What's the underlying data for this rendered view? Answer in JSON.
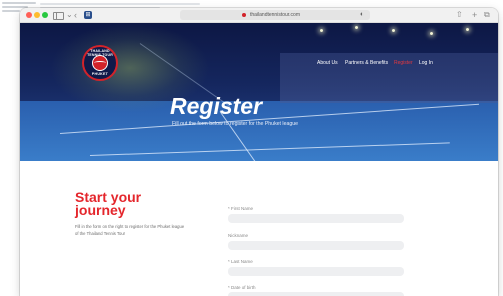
{
  "browser": {
    "url": "thailandtennistour.com"
  },
  "site": {
    "logo_top": "THAILAND TENNIS TOUR",
    "logo_bottom": "PHUKET",
    "nav": [
      "About Us",
      "Partners & Benefits",
      "Register",
      "Log In"
    ],
    "active_nav": "Register"
  },
  "hero": {
    "title": "Register",
    "subtitle": "Fill out the form below to register for the Phuket league"
  },
  "intro": {
    "heading": "Start your journey",
    "description": "Fill in the form on the right to register for the Phuket league of the Thailand Tennis Tour"
  },
  "form": {
    "fields": [
      {
        "label": "* First Name",
        "value": ""
      },
      {
        "label": "Nickname",
        "value": ""
      },
      {
        "label": "* Last Name",
        "value": ""
      },
      {
        "label": "* Date of birth",
        "value": ""
      }
    ]
  },
  "colors": {
    "accent": "#e4262c",
    "navy": "#101a4a"
  }
}
